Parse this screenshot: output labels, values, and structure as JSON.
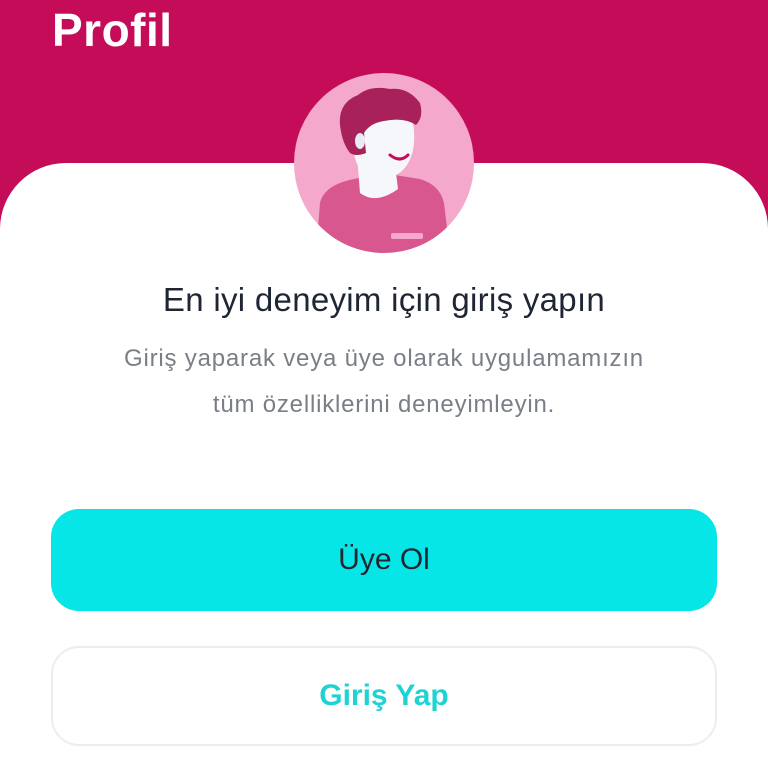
{
  "header": {
    "title": "Profil"
  },
  "avatar": {
    "icon": "user-avatar-illustration",
    "colors": {
      "background": "#f4a8cb",
      "hair": "#a8215a",
      "skin": "#f6f7fb",
      "shirt": "#d8578f"
    }
  },
  "prompt": {
    "heading": "En iyi deneyim için giriş yapın",
    "description": "Giriş yaparak veya üye olarak uygulamamızın tüm özelliklerini deneyimleyin."
  },
  "actions": {
    "signup_label": "Üye Ol",
    "login_label": "Giriş Yap"
  },
  "colors": {
    "brand": "#c40c58",
    "accent": "#07e6e6",
    "accent_text": "#1fd3d3"
  }
}
